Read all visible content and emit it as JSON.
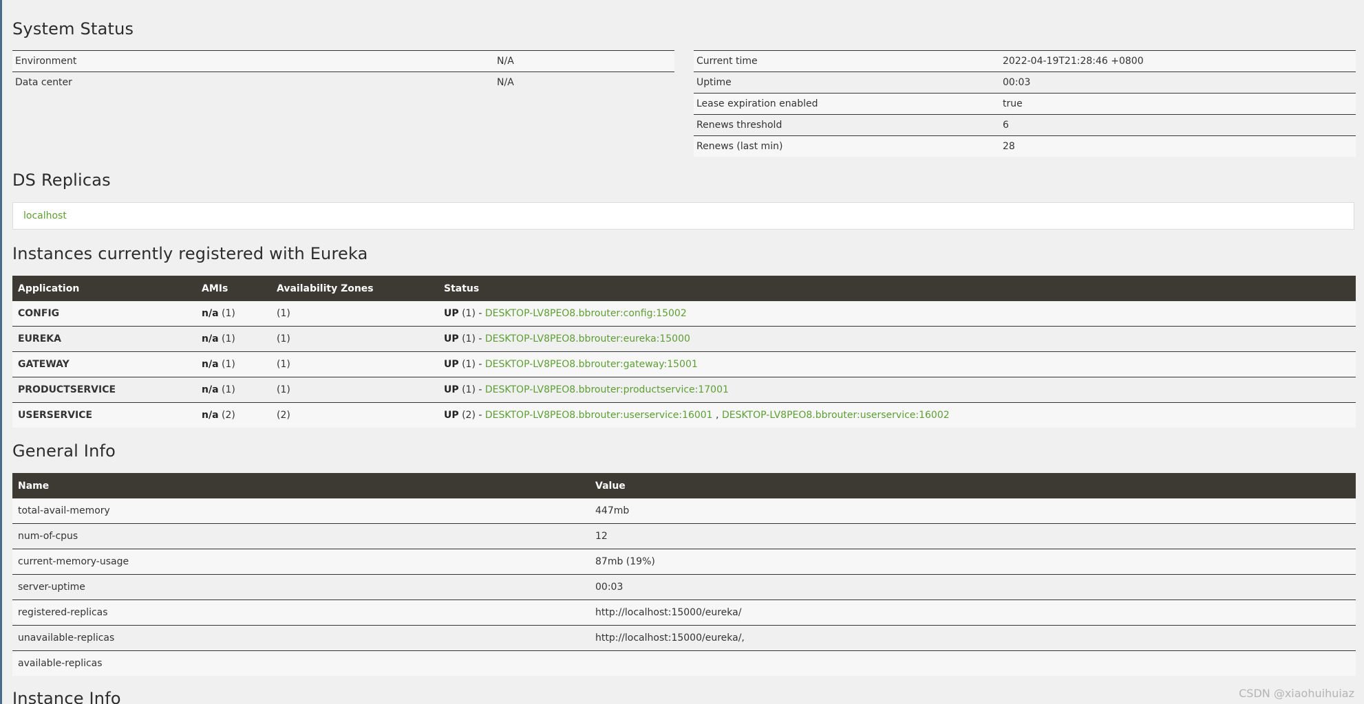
{
  "system_status": {
    "heading": "System Status",
    "left": [
      {
        "label": "Environment",
        "value": "N/A"
      },
      {
        "label": "Data center",
        "value": "N/A"
      }
    ],
    "right": [
      {
        "label": "Current time",
        "value": "2022-04-19T21:28:46 +0800"
      },
      {
        "label": "Uptime",
        "value": "00:03"
      },
      {
        "label": "Lease expiration enabled",
        "value": "true"
      },
      {
        "label": "Renews threshold",
        "value": "6"
      },
      {
        "label": "Renews (last min)",
        "value": "28"
      }
    ]
  },
  "ds_replicas": {
    "heading": "DS Replicas",
    "items": [
      "localhost"
    ]
  },
  "instances": {
    "heading": "Instances currently registered with Eureka",
    "columns": [
      "Application",
      "AMIs",
      "Availability Zones",
      "Status"
    ],
    "rows": [
      {
        "app": "CONFIG",
        "ami_na": "n/a",
        "ami_count": "(1)",
        "zones": "(1)",
        "status": "UP",
        "status_count": "(1) -",
        "links": [
          "DESKTOP-LV8PEO8.bbrouter:config:15002"
        ]
      },
      {
        "app": "EUREKA",
        "ami_na": "n/a",
        "ami_count": "(1)",
        "zones": "(1)",
        "status": "UP",
        "status_count": "(1) -",
        "links": [
          "DESKTOP-LV8PEO8.bbrouter:eureka:15000"
        ]
      },
      {
        "app": "GATEWAY",
        "ami_na": "n/a",
        "ami_count": "(1)",
        "zones": "(1)",
        "status": "UP",
        "status_count": "(1) -",
        "links": [
          "DESKTOP-LV8PEO8.bbrouter:gateway:15001"
        ]
      },
      {
        "app": "PRODUCTSERVICE",
        "ami_na": "n/a",
        "ami_count": "(1)",
        "zones": "(1)",
        "status": "UP",
        "status_count": "(1) -",
        "links": [
          "DESKTOP-LV8PEO8.bbrouter:productservice:17001"
        ]
      },
      {
        "app": "USERSERVICE",
        "ami_na": "n/a",
        "ami_count": "(2)",
        "zones": "(2)",
        "status": "UP",
        "status_count": "(2) -",
        "links": [
          "DESKTOP-LV8PEO8.bbrouter:userservice:16001",
          "DESKTOP-LV8PEO8.bbrouter:userservice:16002"
        ],
        "link_separator": ","
      }
    ]
  },
  "general_info": {
    "heading": "General Info",
    "columns": [
      "Name",
      "Value"
    ],
    "rows": [
      {
        "name": "total-avail-memory",
        "value": "447mb"
      },
      {
        "name": "num-of-cpus",
        "value": "12"
      },
      {
        "name": "current-memory-usage",
        "value": "87mb (19%)"
      },
      {
        "name": "server-uptime",
        "value": "00:03"
      },
      {
        "name": "registered-replicas",
        "value": "http://localhost:15000/eureka/"
      },
      {
        "name": "unavailable-replicas",
        "value": "http://localhost:15000/eureka/,"
      },
      {
        "name": "available-replicas",
        "value": ""
      }
    ]
  },
  "instance_info": {
    "heading": "Instance Info"
  },
  "watermark": "CSDN @xiaohuihuiaz",
  "colors": {
    "link": "#5d9e34",
    "table_header_bg": "#3d3a33",
    "page_bg": "#f0f0f0"
  }
}
